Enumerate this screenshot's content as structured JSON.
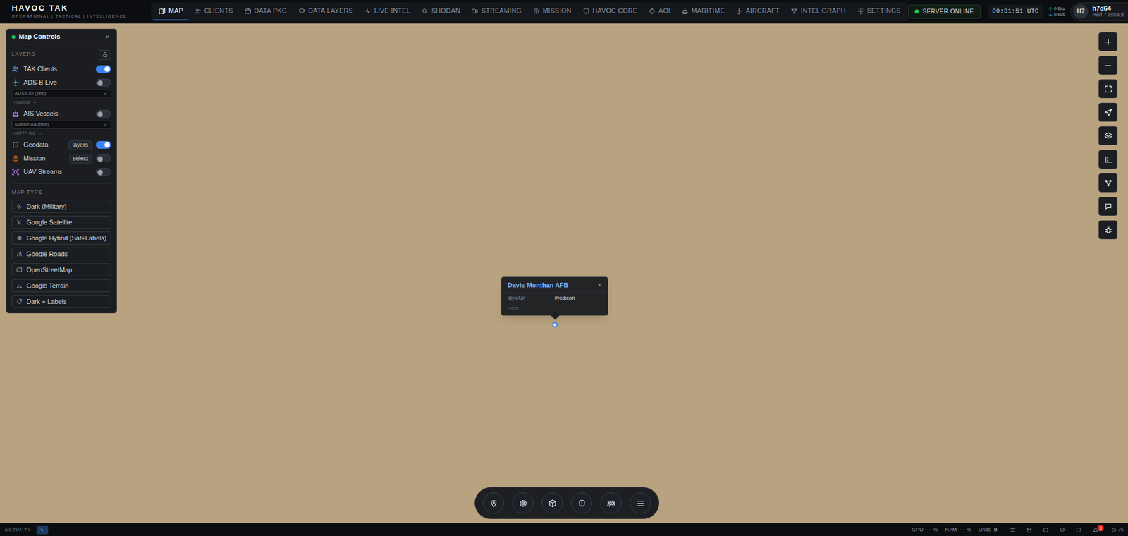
{
  "app": {
    "title": "HAVOC TAK",
    "subtitle": "OPERATIONAL | TACTICAL | INTELLIGENCE"
  },
  "nav": [
    {
      "label": "MAP",
      "selected": true
    },
    {
      "label": "CLIENTS",
      "selected": false
    },
    {
      "label": "DATA PKG",
      "selected": false
    },
    {
      "label": "DATA LAYERS",
      "selected": false
    },
    {
      "label": "LIVE INTEL",
      "selected": false
    },
    {
      "label": "SHODAN",
      "selected": false
    },
    {
      "label": "STREAMING",
      "selected": false
    },
    {
      "label": "MISSION",
      "selected": false
    },
    {
      "label": "HAVOC CORE",
      "selected": false
    },
    {
      "label": "AOI",
      "selected": false
    },
    {
      "label": "MARITIME",
      "selected": false
    },
    {
      "label": "AIRCRAFT",
      "selected": false
    },
    {
      "label": "INTEL GRAPH",
      "selected": false
    },
    {
      "label": "SETTINGS",
      "selected": false
    }
  ],
  "header": {
    "server_status": "SERVER ONLINE",
    "server_online": true,
    "clock": "09:31:51 UTC",
    "net_up": "0 B/s",
    "net_down": "0 B/s",
    "avatar": "H7",
    "user": "h7d64",
    "role": "Red 7 assault"
  },
  "map_controls": {
    "title": "Map Controls",
    "close": "×",
    "layers_heading": "LAYERS",
    "layers": [
      {
        "label": "TAK Clients",
        "on": true,
        "kind": "toggle",
        "color": "#60a5fa"
      },
      {
        "label": "ADS-B Live",
        "on": false,
        "kind": "source",
        "color": "#38bdf8",
        "source": "ADSB.lol (free)",
        "status": "× cached · --"
      },
      {
        "label": "AIS Vessels",
        "on": false,
        "kind": "source",
        "color": "#a78bfa",
        "source": "MarineSIA (free)",
        "status": "× HTTP 403 · --"
      },
      {
        "label": "Geodata",
        "on": true,
        "kind": "button",
        "color": "#f59e0b",
        "button": "layers"
      },
      {
        "label": "Mission",
        "on": false,
        "kind": "button",
        "color": "#f97316",
        "button": "select"
      },
      {
        "label": "UAV Streams",
        "on": false,
        "kind": "toggle",
        "color": "#c084fc"
      }
    ],
    "map_type_heading": "MAP TYPE",
    "map_types": [
      {
        "label": "Dark (Military)",
        "selected": false
      },
      {
        "label": "Google Satellite",
        "selected": false
      },
      {
        "label": "Google Hybrid (Sat+Labels)",
        "selected": false
      },
      {
        "label": "Google Roads",
        "selected": false
      },
      {
        "label": "OpenStreetMap",
        "selected": false
      },
      {
        "label": "Google Terrain",
        "selected": false
      },
      {
        "label": "Dark + Labels",
        "selected": false
      }
    ]
  },
  "popup": {
    "title": "Davis Monthan AFB",
    "close": "×",
    "rows": [
      {
        "key": "styleUrl",
        "value": "#redicon"
      }
    ],
    "footer": "Point"
  },
  "status_bar": {
    "activity": "ACTIVITY",
    "cpu_label": "CPU",
    "cpu": "–",
    "cpu_unit": "%",
    "ram_label": "RAM",
    "ram": "–",
    "ram_unit": "%",
    "units_label": "Units",
    "units": "0",
    "alerts": "3",
    "ai": "Ai"
  }
}
